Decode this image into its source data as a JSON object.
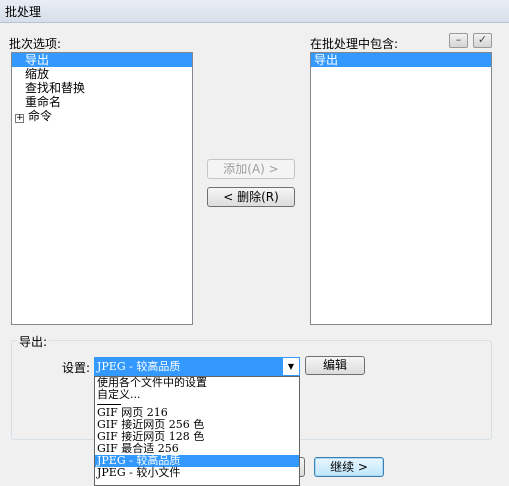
{
  "window": {
    "title": "批处理"
  },
  "batch_options": {
    "label": "批次选项:",
    "items": [
      {
        "label": "导出",
        "selected": true
      },
      {
        "label": "缩放",
        "selected": false
      },
      {
        "label": "查找和替换",
        "selected": false
      },
      {
        "label": "重命名",
        "selected": false
      }
    ],
    "tree_item": {
      "expander": "+",
      "label": "命令"
    }
  },
  "included": {
    "label": "在批处理中包含:",
    "items": [
      {
        "label": "导出",
        "selected": true
      }
    ],
    "move_up_icon": "minus-icon",
    "move_down_icon": "checkmark-icon"
  },
  "buttons": {
    "add": "添加(A) >",
    "remove": "< 删除(R)",
    "edit": "编辑",
    "continue": "继续 >"
  },
  "export": {
    "group_label": "导出:",
    "settings_label": "设置:",
    "settings_value": "JPEG - 较高品质",
    "dropdown_arrow": "▼",
    "options": [
      {
        "label": "使用各个文件中的设置",
        "type": "option"
      },
      {
        "label": "自定义...",
        "type": "option"
      },
      {
        "type": "separator"
      },
      {
        "label": "GIF 网页 216",
        "type": "option"
      },
      {
        "label": "GIF 接近网页 256 色",
        "type": "option"
      },
      {
        "label": "GIF 接近网页 128 色",
        "type": "option"
      },
      {
        "label": "GIF 最合适 256",
        "type": "option"
      },
      {
        "label": "JPEG - 较高品质",
        "type": "option",
        "selected": true
      },
      {
        "label": "JPEG - 较小文件",
        "type": "option"
      }
    ]
  },
  "colors": {
    "selection": "#3399ff",
    "background": "#f0f0f0"
  }
}
